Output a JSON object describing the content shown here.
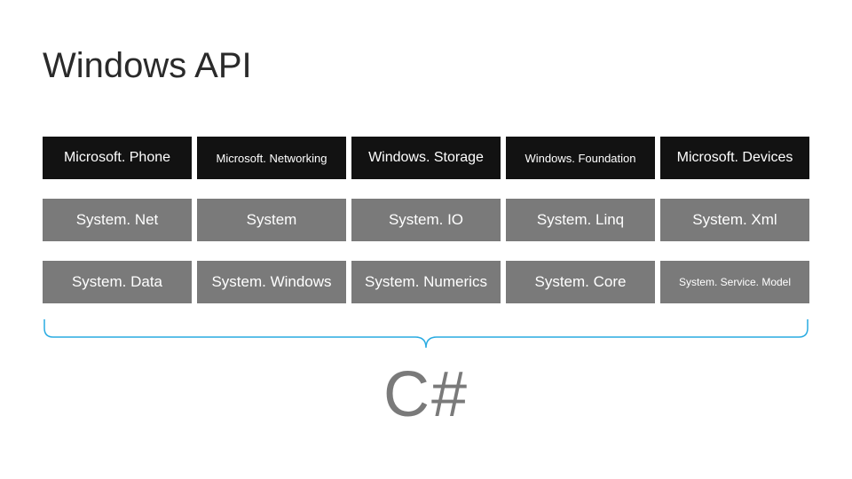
{
  "title": "Windows API",
  "rows": [
    [
      "Microsoft. Phone",
      "Microsoft. Networking",
      "Windows. Storage",
      "Windows. Foundation",
      "Microsoft. Devices"
    ],
    [
      "System. Net",
      "System",
      "System. IO",
      "System. Linq",
      "System. Xml"
    ],
    [
      "System. Data",
      "System. Windows",
      "System. Numerics",
      "System. Core",
      "System. Service. Model"
    ]
  ],
  "language_label": "C#",
  "colors": {
    "row0_bg": "#121212",
    "row_other_bg": "#7a7a7a",
    "brace": "#29abe2",
    "title": "#2a2a2a"
  }
}
